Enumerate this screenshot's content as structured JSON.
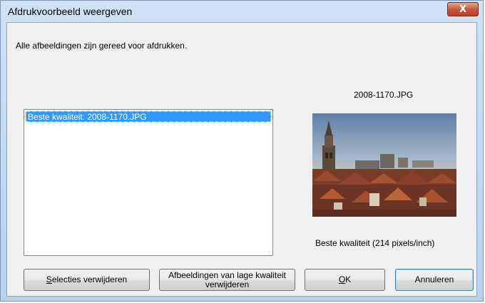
{
  "window": {
    "title": "Afdrukvoorbeeld weergeven",
    "close_glyph": "X"
  },
  "status_text": "Alle afbeeldingen zijn gereed voor afdrukken.",
  "image_list": {
    "items": [
      {
        "label": "Beste kwaliteit: 2008-1170.JPG",
        "selected": true
      }
    ]
  },
  "preview": {
    "filename": "2008-1170.JPG",
    "quality_text": "Beste kwaliteit (214 pixels/inch)"
  },
  "buttons": {
    "remove_selections": {
      "access_key": "S",
      "rest": "electies verwijderen"
    },
    "remove_low_quality": {
      "line1": "Afbeeldingen van lage kwaliteit",
      "line2": "verwijderen"
    },
    "ok": {
      "access_key": "O",
      "rest": "K"
    },
    "cancel": "Annuleren"
  },
  "colors": {
    "selection": "#3399ff",
    "close_button": "#c7523a",
    "dialog_face": "#f0f0f0"
  }
}
